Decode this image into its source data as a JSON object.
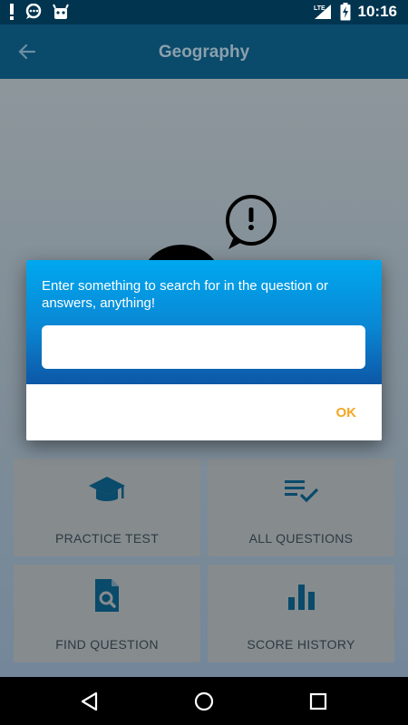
{
  "status_bar": {
    "time": "10:16",
    "network": "LTE",
    "icons": [
      "alert-icon",
      "chat-bubble-icon",
      "android-icon",
      "signal-icon",
      "battery-charging-icon"
    ]
  },
  "app_bar": {
    "title": "Geography",
    "back_icon": "arrow-left-icon"
  },
  "dialog": {
    "message": "Enter something to search for in the question or answers, anything!",
    "input_value": "",
    "ok_label": "OK"
  },
  "tiles": [
    {
      "label": "PRACTICE TEST",
      "icon": "graduation-cap-icon"
    },
    {
      "label": "ALL QUESTIONS",
      "icon": "checklist-icon"
    },
    {
      "label": "FIND QUESTION",
      "icon": "document-search-icon"
    },
    {
      "label": "SCORE HISTORY",
      "icon": "bar-chart-icon"
    }
  ],
  "nav_bar": {
    "icons": [
      "back-triangle-icon",
      "home-circle-icon",
      "recents-square-icon"
    ]
  },
  "colors": {
    "status_bar": "#00344f",
    "app_bar": "#0a4a6a",
    "dialog_gradient_top": "#00a8ef",
    "dialog_gradient_bottom": "#0d57a6",
    "ok_button": "#f5a623",
    "tile_icon": "#0a4a6a"
  }
}
